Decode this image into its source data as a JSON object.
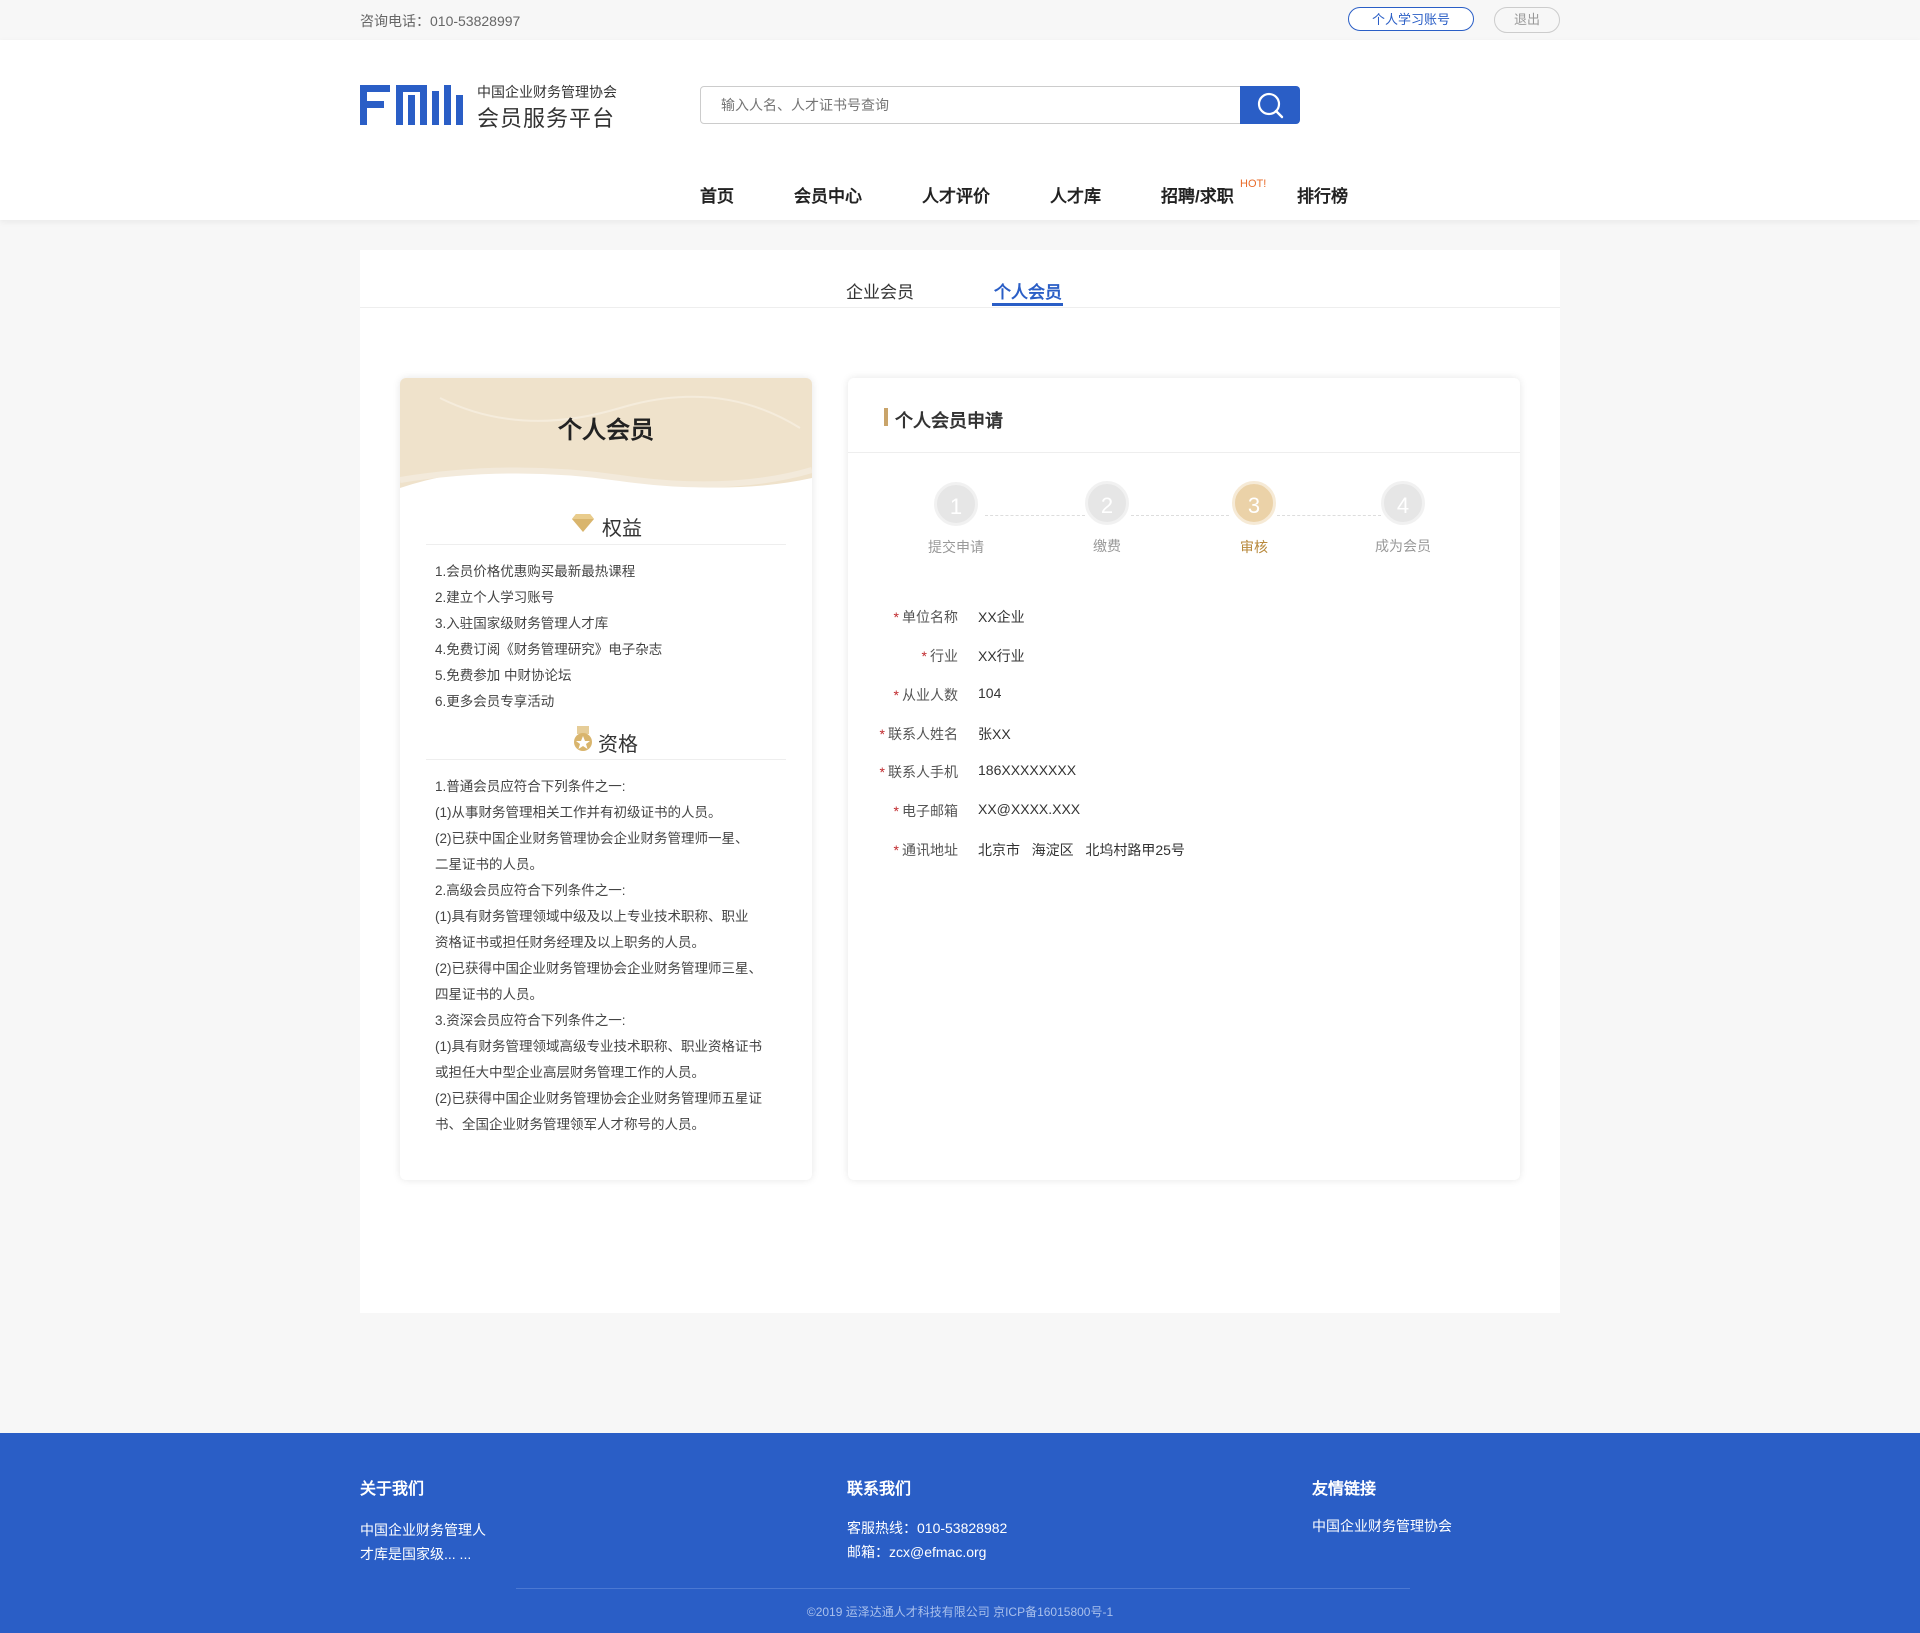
{
  "topbar": {
    "phone": "咨询电话：010-53828997",
    "account_button": "个人学习账号",
    "logout_button": "退出"
  },
  "logo": {
    "mark_text": "FMI",
    "small_text": "中国企业财务管理协会",
    "big_text": "会员服务平台"
  },
  "search": {
    "placeholder": "输入人名、人才证书号查询"
  },
  "nav": {
    "items": [
      "首页",
      "会员中心",
      "人才评价",
      "人才库",
      "招聘/求职",
      "排行榜"
    ],
    "hot_badge": "HOT!"
  },
  "tabs": {
    "items": [
      "企业会员",
      "个人会员"
    ],
    "active_index": 1
  },
  "membership_card": {
    "title": "个人会员",
    "benefits_title": "权益",
    "benefits": [
      "1.会员价格优惠购买最新最热课程",
      "2.建立个人学习账号",
      "3.入驻国家级财务管理人才库",
      "4.免费订阅《财务管理研究》电子杂志",
      "5.免费参加 中财协论坛",
      "6.更多会员专享活动"
    ],
    "qualifications_title": "资格",
    "qualifications": [
      "1.普通会员应符合下列条件之一:",
      "(1)从事财务管理相关工作并有初级证书的人员。",
      "(2)已获中国企业财务管理协会企业财务管理师一星、",
      "二星证书的人员。",
      "2.高级会员应符合下列条件之一:",
      "(1)具有财务管理领域中级及以上专业技术职称、职业",
      "资格证书或担任财务经理及以上职务的人员。",
      "(2)已获得中国企业财务管理协会企业财务管理师三星、",
      "四星证书的人员。",
      "3.资深会员应符合下列条件之一:",
      "(1)具有财务管理领域高级专业技术职称、职业资格证书",
      "或担任大中型企业高层财务管理工作的人员。",
      "(2)已获得中国企业财务管理协会企业财务管理师五星证",
      "书、全国企业财务管理领军人才称号的人员。"
    ]
  },
  "application": {
    "title": "个人会员申请",
    "steps": [
      {
        "num": "1",
        "label": "提交申请"
      },
      {
        "num": "2",
        "label": "缴费"
      },
      {
        "num": "3",
        "label": "审核"
      },
      {
        "num": "4",
        "label": "成为会员"
      }
    ],
    "current_step": 3,
    "fields": [
      {
        "label": "单位名称",
        "value": "XX企业"
      },
      {
        "label": "行业",
        "value": "XX行业"
      },
      {
        "label": "从业人数",
        "value": "104"
      },
      {
        "label": "联系人姓名",
        "value": "张XX"
      },
      {
        "label": "联系人手机",
        "value": "186XXXXXXXX"
      },
      {
        "label": "电子邮箱",
        "value": "XX@XXXX.XXX"
      },
      {
        "label": "通讯地址",
        "value": "北京市   海淀区   北坞村路甲25号"
      }
    ],
    "required_mark": "*"
  },
  "footer": {
    "about_title": "关于我们",
    "about_text_1": "中国企业财务管理人",
    "about_text_2": "才库是国家级... ...",
    "contact_title": "联系我们",
    "hotline": "客服热线：010-53828982",
    "email": "邮箱：zcx@efmac.org",
    "links_title": "友情链接",
    "link_1": "中国企业财务管理协会",
    "copyright": "©2019 运泽达通人才科技有限公司  京ICP备16015800号-1"
  },
  "colors": {
    "brand_blue": "#2a5ec6",
    "gold": "#c9a46a",
    "hot_orange": "#e86b2a",
    "required_red": "#c0282c"
  }
}
